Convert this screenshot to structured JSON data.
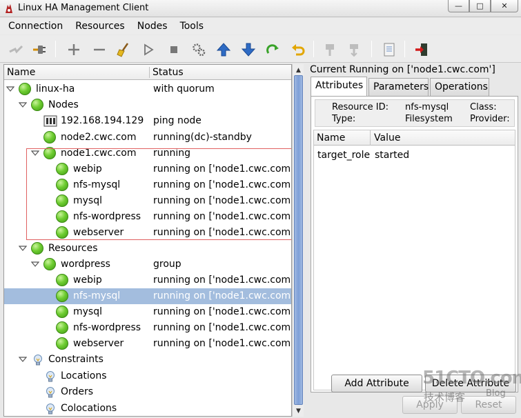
{
  "window": {
    "title": "Linux HA Management Client",
    "buttons": [
      "—",
      "□",
      "✕"
    ]
  },
  "menu": [
    "Connection",
    "Resources",
    "Nodes",
    "Tools"
  ],
  "toolbar": {
    "icons": [
      "disconnect-icon",
      "connect-icon",
      "add-icon",
      "remove-icon",
      "cleanup-broom-icon",
      "start-icon",
      "stop-icon",
      "gears-icon",
      "move-up-icon",
      "move-down-icon",
      "refresh-icon",
      "undo-icon",
      "standby-icon",
      "active-icon",
      "view-document-icon",
      "exit-icon"
    ]
  },
  "tree": {
    "columns": {
      "name": "Name",
      "status": "Status"
    },
    "rows": [
      {
        "label": "linux-ha",
        "status": "with quorum",
        "icon": "green-status-icon",
        "expanded": true
      },
      {
        "label": "Nodes",
        "status": "",
        "icon": "green-status-icon",
        "expanded": true
      },
      {
        "label": "192.168.194.129",
        "status": "ping node",
        "icon": "ping-node-icon"
      },
      {
        "label": "node2.cwc.com",
        "status": "running(dc)-standby",
        "icon": "green-status-icon"
      },
      {
        "label": "node1.cwc.com",
        "status": "running",
        "icon": "green-status-icon",
        "expanded": true
      },
      {
        "label": "webip",
        "status": "running on ['node1.cwc.com']",
        "icon": "green-status-icon"
      },
      {
        "label": "nfs-mysql",
        "status": "running on ['node1.cwc.com']",
        "icon": "green-status-icon"
      },
      {
        "label": "mysql",
        "status": "running on ['node1.cwc.com']",
        "icon": "green-status-icon"
      },
      {
        "label": "nfs-wordpress",
        "status": "running on ['node1.cwc.com']",
        "icon": "green-status-icon"
      },
      {
        "label": "webserver",
        "status": "running on ['node1.cwc.com']",
        "icon": "green-status-icon"
      },
      {
        "label": "Resources",
        "status": "",
        "icon": "green-status-icon",
        "expanded": true
      },
      {
        "label": "wordpress",
        "status": "group",
        "icon": "green-status-icon",
        "expanded": true
      },
      {
        "label": "webip",
        "status": "running on ['node1.cwc.com']",
        "icon": "green-status-icon"
      },
      {
        "label": "nfs-mysql",
        "status": "running on ['node1.cwc.com']",
        "icon": "green-status-icon",
        "selected": true
      },
      {
        "label": "mysql",
        "status": "running on ['node1.cwc.com']",
        "icon": "green-status-icon"
      },
      {
        "label": "nfs-wordpress",
        "status": "running on ['node1.cwc.com']",
        "icon": "green-status-icon"
      },
      {
        "label": "webserver",
        "status": "running on ['node1.cwc.com']",
        "icon": "green-status-icon"
      },
      {
        "label": "Constraints",
        "status": "",
        "icon": "lightbulb-icon",
        "expanded": true
      },
      {
        "label": "Locations",
        "status": "",
        "icon": "lightbulb-icon"
      },
      {
        "label": "Orders",
        "status": "",
        "icon": "lightbulb-icon"
      },
      {
        "label": "Colocations",
        "status": "",
        "icon": "lightbulb-icon"
      }
    ]
  },
  "detail": {
    "title": "Current Running on ['node1.cwc.com']",
    "tabs": [
      "Attributes",
      "Parameters",
      "Operations"
    ],
    "info": {
      "resource_id_label": "Resource ID:",
      "resource_id": "nfs-mysql",
      "type_label": "Type:",
      "type": "Filesystem",
      "class_label": "Class:",
      "provider_label": "Provider:"
    },
    "table": {
      "columns": [
        "Name",
        "Value"
      ],
      "rows": [
        {
          "name": "target_role",
          "value": "started"
        }
      ]
    },
    "buttons": {
      "add_attribute": "Add Attribute",
      "delete_attribute": "Delete Attribute",
      "apply": "Apply",
      "reset": "Reset"
    }
  },
  "watermark": {
    "logo": "51CTO.com",
    "sub": "技术博客",
    "blog": "Blog"
  },
  "colors": {
    "selection": "#a3bdde",
    "status_green": "#6fcd32",
    "highlight_box": "#e06060",
    "scroll_thumb": "#7d9fd8"
  }
}
